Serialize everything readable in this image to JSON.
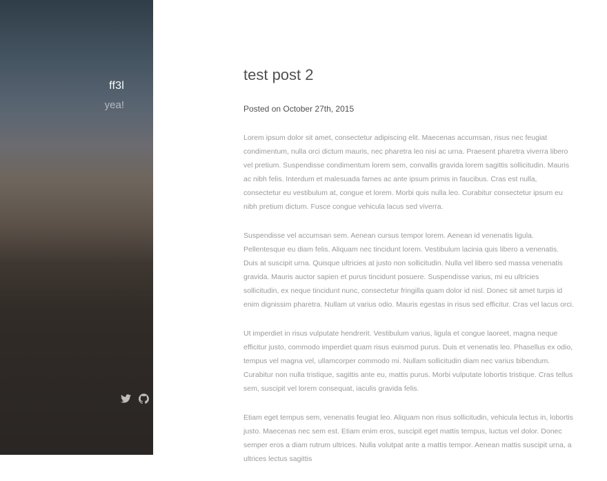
{
  "sidebar": {
    "site_title": "ff3l",
    "tagline": "yea!",
    "social": [
      {
        "icon": "twitter-icon"
      },
      {
        "icon": "github-icon"
      }
    ],
    "icon_color": "#bdbdbd"
  },
  "post": {
    "title": "test post 2",
    "date": "Posted on October 27th, 2015",
    "paragraphs": [
      "Lorem ipsum dolor sit amet, consectetur adipiscing elit. Maecenas accumsan, risus nec feugiat condimentum, nulla orci dictum mauris, nec pharetra leo nisi ac urna. Praesent pharetra viverra libero vel pretium. Suspendisse condimentum lorem sem, convallis gravida lorem sagittis sollicitudin. Mauris ac nibh felis. Interdum et malesuada fames ac ante ipsum primis in faucibus. Cras est nulla, consectetur eu vestibulum at, congue et lorem. Morbi quis nulla leo. Curabitur consectetur ipsum eu nibh pretium dictum. Fusce congue vehicula lacus sed viverra.",
      "Suspendisse vel accumsan sem. Aenean cursus tempor lorem. Aenean id venenatis ligula. Pellentesque eu diam felis. Aliquam nec tincidunt lorem. Vestibulum lacinia quis libero a venenatis. Duis at suscipit urna. Quisque ultricies at justo non sollicitudin. Nulla vel libero sed massa venenatis gravida. Mauris auctor sapien et purus tincidunt posuere. Suspendisse varius, mi eu ultricies sollicitudin, ex neque tincidunt nunc, consectetur fringilla quam dolor id nisl. Donec sit amet turpis id enim dignissim pharetra. Nullam ut varius odio. Mauris egestas in risus sed efficitur. Cras vel lacus orci.",
      "Ut imperdiet in risus vulputate hendrerit. Vestibulum varius, ligula et congue laoreet, magna neque efficitur justo, commodo imperdiet quam risus euismod purus. Duis et venenatis leo. Phasellus ex odio, tempus vel magna vel, ullamcorper commodo mi. Nullam sollicitudin diam nec varius bibendum. Curabitur non nulla tristique, sagittis ante eu, mattis purus. Morbi vulputate lobortis tristique. Cras tellus sem, suscipit vel lorem consequat, iaculis gravida felis.",
      "Etiam eget tempus sem, venenatis feugiat leo. Aliquam non risus sollicitudin, vehicula lectus in, lobortis justo. Maecenas nec sem est. Etiam enim eros, suscipit eget mattis tempus, luctus vel dolor. Donec semper eros a diam rutrum ultrices. Nulla volutpat ante a mattis tempor. Aenean mattis suscipit urna, a ultrices lectus sagittis"
    ]
  }
}
